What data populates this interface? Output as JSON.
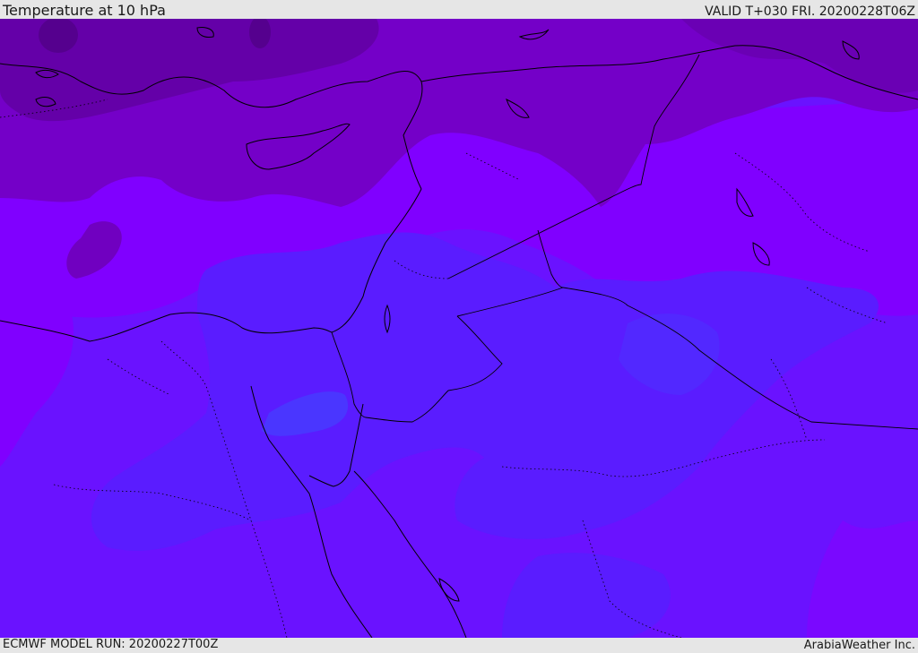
{
  "header": {
    "title": "Temperature at 10 hPa",
    "valid": "VALID T+030 FRI. 20200228T06Z"
  },
  "footer": {
    "model_run": "ECMWF MODEL RUN: 20200227T00Z",
    "credit": "ArabiaWeather Inc."
  },
  "map": {
    "field": "temperature",
    "level": "10 hPa",
    "region": "Eastern Mediterranean / Levant",
    "colors": {
      "darkest_purple": "#5f00a0",
      "dark_purple": "#7000b8",
      "purple": "#7a00d6",
      "violet": "#8000ff",
      "blue_violet": "#6a10ff",
      "indigo": "#5a1cff",
      "blue": "#4a30ff",
      "coastline": "#000000"
    }
  }
}
